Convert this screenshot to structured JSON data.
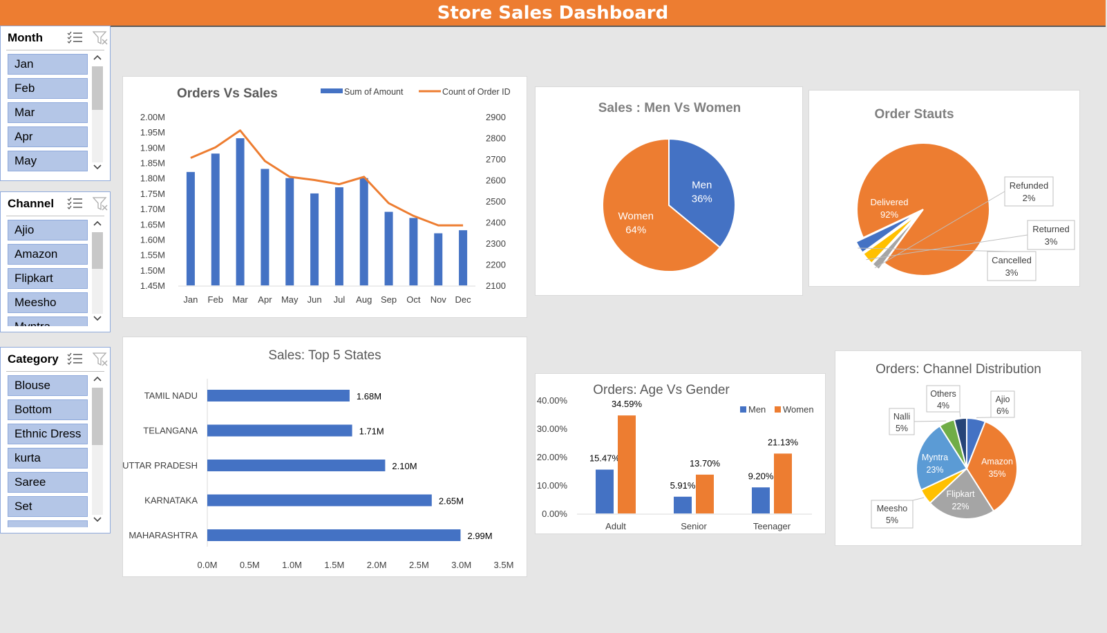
{
  "dashboard": {
    "title": "Store Sales Dashboard"
  },
  "slicers": [
    {
      "title": "Month",
      "items": [
        "Jan",
        "Feb",
        "Mar",
        "Apr",
        "May"
      ]
    },
    {
      "title": "Channel",
      "items": [
        "Ajio",
        "Amazon",
        "Flipkart",
        "Meesho",
        "Myntra"
      ]
    },
    {
      "title": "Category",
      "items": [
        "Blouse",
        "Bottom",
        "Ethnic Dress",
        "kurta",
        "Saree",
        "Set",
        ""
      ]
    }
  ],
  "icons": {
    "multi_select": "multi-select-icon",
    "clear_filter": "clear-filter-icon",
    "scroll_up": "chevron-up-icon",
    "scroll_down": "chevron-down-icon"
  },
  "colors": {
    "blue": "#4472c4",
    "orange": "#ed7d31",
    "gray": "#a5a5a5",
    "yellow": "#ffc000",
    "light_blue": "#5b9bd5",
    "green": "#70ad47",
    "dark_blue": "#264478",
    "title_bar": "#ed7d31",
    "slicer_item": "#b4c6e7"
  },
  "chart_data": [
    {
      "id": "orders-vs-sales",
      "type": "bar",
      "title": "Orders Vs Sales",
      "categories": [
        "Jan",
        "Feb",
        "Mar",
        "Apr",
        "May",
        "Jun",
        "Jul",
        "Aug",
        "Sep",
        "Oct",
        "Nov",
        "Dec"
      ],
      "series": [
        {
          "name": "Sum of Amount",
          "kind": "bar",
          "axis": "primary",
          "values": [
            1.82,
            1.88,
            1.93,
            1.83,
            1.8,
            1.75,
            1.77,
            1.8,
            1.69,
            1.67,
            1.62,
            1.63
          ]
        },
        {
          "name": "Count of Order ID",
          "kind": "line",
          "axis": "secondary",
          "values": [
            2705,
            2755,
            2835,
            2690,
            2615,
            2600,
            2580,
            2615,
            2490,
            2430,
            2385,
            2385
          ]
        }
      ],
      "y_ticks": [
        "2.00M",
        "1.95M",
        "1.90M",
        "1.85M",
        "1.80M",
        "1.75M",
        "1.70M",
        "1.65M",
        "1.60M",
        "1.55M",
        "1.50M",
        "1.45M"
      ],
      "y2_ticks": [
        "2900",
        "2800",
        "2700",
        "2600",
        "2500",
        "2400",
        "2300",
        "2200",
        "2100"
      ],
      "ylim": [
        1.45,
        2.0
      ],
      "y2lim": [
        2100,
        2900
      ],
      "legend": "top-right",
      "grid": false
    },
    {
      "id": "sales-men-vs-women",
      "type": "pie",
      "title": "Sales : Men Vs Women",
      "labels": [
        "Men",
        "Women"
      ],
      "values": [
        36,
        64
      ],
      "value_labels": [
        "36%",
        "64%"
      ],
      "colors": [
        "#4472c4",
        "#ed7d31"
      ]
    },
    {
      "id": "order-status",
      "type": "pie",
      "title": "Order Stauts",
      "labels": [
        "Delivered",
        "Refunded",
        "Returned",
        "Cancelled"
      ],
      "values": [
        92,
        2,
        3,
        3
      ],
      "value_labels": [
        "92%",
        "2%",
        "3%",
        "3%"
      ],
      "colors": [
        "#ed7d31",
        "#a5a5a5",
        "#ffc000",
        "#4472c4"
      ]
    },
    {
      "id": "top-5-states",
      "type": "bar",
      "orientation": "horizontal",
      "title": "Sales: Top 5 States",
      "categories": [
        "TAMIL NADU",
        "TELANGANA",
        "UTTAR PRADESH",
        "KARNATAKA",
        "MAHARASHTRA"
      ],
      "values": [
        1.68,
        1.71,
        2.1,
        2.65,
        2.99
      ],
      "value_labels": [
        "1.68M",
        "1.71M",
        "2.10M",
        "2.65M",
        "2.99M"
      ],
      "x_ticks": [
        "0.0M",
        "0.5M",
        "1.0M",
        "1.5M",
        "2.0M",
        "2.5M",
        "3.0M",
        "3.5M"
      ],
      "xlim": [
        0,
        3.5
      ]
    },
    {
      "id": "age-vs-gender",
      "type": "bar",
      "title": "Orders: Age Vs Gender",
      "categories": [
        "Adult",
        "Senior",
        "Teenager"
      ],
      "series": [
        {
          "name": "Men",
          "values": [
            15.47,
            5.91,
            9.2
          ],
          "value_labels": [
            "15.47%",
            "5.91%",
            "9.20%"
          ]
        },
        {
          "name": "Women",
          "values": [
            34.59,
            13.7,
            21.13
          ],
          "value_labels": [
            "34.59%",
            "13.70%",
            "21.13%"
          ]
        }
      ],
      "y_ticks": [
        "40.00%",
        "30.00%",
        "20.00%",
        "10.00%",
        "0.00%"
      ],
      "ylim": [
        0,
        40
      ],
      "legend": "top-right"
    },
    {
      "id": "channel-distribution",
      "type": "pie",
      "title": "Orders: Channel Distribution",
      "labels": [
        "Ajio",
        "Amazon",
        "Flipkart",
        "Meesho",
        "Myntra",
        "Nalli",
        "Others"
      ],
      "values": [
        6,
        35,
        22,
        5,
        23,
        5,
        4
      ],
      "value_labels": [
        "6%",
        "35%",
        "22%",
        "5%",
        "23%",
        "5%",
        "4%"
      ],
      "colors": [
        "#4472c4",
        "#ed7d31",
        "#a5a5a5",
        "#ffc000",
        "#5b9bd5",
        "#70ad47",
        "#264478"
      ]
    }
  ]
}
